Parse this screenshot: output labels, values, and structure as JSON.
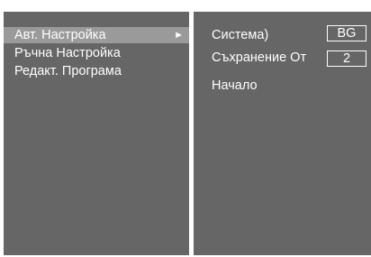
{
  "menu": {
    "items": [
      {
        "label": "Авт. Настройка",
        "selected": true,
        "arrow": "►"
      },
      {
        "label": "Ръчна Настройка",
        "selected": false
      },
      {
        "label": "Редакт. Програма",
        "selected": false
      }
    ]
  },
  "settings": {
    "system_label": "Система)",
    "system_value": "BG",
    "save_from_label": "Съхранение От",
    "save_from_value": "2",
    "start_label": "Начало"
  },
  "colors": {
    "panel": "#666666",
    "highlight": "#9a9a9a",
    "text": "#ffffff"
  }
}
